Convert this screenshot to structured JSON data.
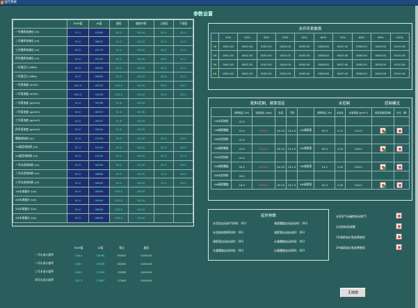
{
  "window": {
    "title": "运行系统"
  },
  "page": {
    "title": "参数设置"
  },
  "main_table": {
    "headers": [
      "",
      "RDM值",
      "AI值",
      "量程",
      "偏差补偿",
      "上限值",
      "下限值"
    ],
    "rows": [
      [
        "一号搅拌池液位 (m)",
        "21.1",
        "20584",
        "02.2",
        "00.00",
        "01.5",
        "01.4"
      ],
      [
        "二号搅拌池液位 (m)",
        "00.0",
        "08822",
        "02.2",
        "00.00",
        "01.5",
        "01.5"
      ],
      [
        "三号搅拌池液位 (m)",
        "00.0",
        "18770",
        "02.2",
        "00.00",
        "04.5",
        "01.2"
      ],
      [
        "四号搅拌池液位 (m)",
        "00.0",
        "09332",
        "02.2",
        "00.00",
        "04.5",
        "01.2"
      ],
      [
        "一号泵压力 (MPa)",
        "00.0",
        "08950",
        "25.0",
        "00.00",
        "05.0",
        "01.2"
      ],
      [
        "二号泵压力 (MPa)",
        "00.0",
        "08869",
        "25.0",
        "00.00",
        "05.0",
        "01.2"
      ],
      [
        "一号泵流量 (m3/h)",
        "000.0",
        "08325",
        "025.0",
        "00.00",
        "05.0",
        "00.2"
      ],
      [
        "二号泵流量 (m3/h)",
        "000.0",
        "09000",
        "025.0",
        "00.00",
        "05.0",
        "00.2"
      ],
      [
        "一号泵浓度 (g/cm3)",
        "00.0",
        "08789",
        "01.6",
        "00.00",
        "",
        ""
      ],
      [
        "二号泵浓度 (g/cm3)",
        "00.0",
        "08597",
        "01.6",
        "00.00",
        "",
        ""
      ],
      [
        "三号泵浓度 (g/cm3)",
        "00.0",
        "08057",
        "01.6",
        "00.00",
        "",
        ""
      ],
      [
        "四号泵浓度 (g/cm3)",
        "00.0",
        "08500",
        "01.6",
        "00.00",
        "",
        ""
      ],
      [
        "螺旋给料机 (m)",
        "02.8",
        "22029",
        "05.2",
        "00.00",
        "02.5",
        "00.5"
      ],
      [
        "1#粗泥给料机 (m)",
        "02.3",
        "22029",
        "05.2",
        "00.00",
        "02.3",
        "00.5"
      ],
      [
        "2#粗泥给料机 (m)",
        "00.0",
        "10000",
        "05.2",
        "00.00",
        "02.5",
        "01.3"
      ],
      [
        "一号水泥给料机 (m)",
        "00.0",
        "08900",
        "05.2",
        "00.00",
        "01.5",
        "00.5"
      ],
      [
        "二号水泥给料机 (m)",
        "00.0",
        "08860",
        "05.2",
        "00.00",
        "11.5",
        "00.5"
      ],
      [
        "三号水泥给料机 (m)",
        "00.0",
        "08600",
        "05.2",
        "00.00",
        "11.5",
        "00.5"
      ],
      [
        "1#水流量计 (L/s)",
        "00.0",
        "08900",
        "025.0",
        "00.00",
        "",
        ""
      ],
      [
        "2#水流量计 (L/s)",
        "00.0",
        "08900",
        "025.0",
        "00.00",
        "",
        ""
      ],
      [
        "3#水流量计 (L/s)",
        "00.0",
        "08800",
        "025.0",
        "00.00",
        "",
        ""
      ],
      [
        "4#水流量计 (L/s)",
        "00.0",
        "08800",
        "025.0",
        "00.00",
        "",
        ""
      ]
    ]
  },
  "flow_table": {
    "headers": [
      "",
      "RDM值",
      "AI值",
      "零点",
      "量值"
    ],
    "rows": [
      [
        "一号水流计量秤",
        "148.4",
        "18090",
        "00200",
        "0100.00"
      ],
      [
        "二号水流计量秤",
        "146.3",
        "20009",
        "00200",
        "0100.00"
      ],
      [
        "三号水流计量秤",
        "146.2",
        "17659",
        "15200",
        "0100.00"
      ],
      [
        "四号水流计量秤",
        "141.3",
        "17867",
        "17300",
        "0100.00"
      ]
    ]
  },
  "water_table": {
    "title": "水开环系数表",
    "headers": [
      "",
      "10%",
      "20%",
      "30%",
      "40%",
      "50%",
      "60%",
      "70%",
      "80%",
      "90%",
      "100%"
    ],
    "rows": [
      [
        "1#",
        "0001.00",
        "0002.00",
        "0003.00",
        "0004.00",
        "0005.00",
        "0006.00",
        "0007.00",
        "0008.00",
        "0009.00",
        "0010.00"
      ],
      [
        "2#",
        "0001.00",
        "0002.00",
        "0003.00",
        "0004.00",
        "0005.00",
        "0006.00",
        "0007.00",
        "0008.00",
        "0009.00",
        "0010.00"
      ],
      [
        "3#",
        "0001.00",
        "0002.00",
        "0003.00",
        "0004.00",
        "0005.00",
        "0006.00",
        "0007.00",
        "0008.00",
        "0009.00",
        "0010.00"
      ],
      [
        "4#",
        "0001.00",
        "0002.00",
        "0003.00",
        "0004.00",
        "0005.00",
        "0006.00",
        "0007.00",
        "0008.00",
        "0009.00",
        "0010.00"
      ]
    ]
  },
  "config": {
    "section_title": "配料控制、频率设定",
    "water_title": "水控制",
    "mode_title": "控制模式",
    "headers": [
      "",
      "频率给定 (Hz)",
      "流量设定 (kg/s)",
      "补偿",
      "下限",
      "",
      "频率给定 (Hz)",
      "水泥比",
      "水泥密度 (g/cm3)",
      "泥浆密度控制阀",
      "水开、调F"
    ],
    "rows": [
      [
        "1#水泥给料",
        "22.0",
        "",
        "",
        "",
        "",
        "",
        "",
        "",
        "",
        ""
      ],
      [
        "1#调浆螺旋",
        "22.0",
        "0000.0",
        "00.20",
        "011.0",
        "1#调浆泵",
        "00.0",
        "1.12",
        "112.0",
        "on",
        "F"
      ],
      [
        "2#水泥给料",
        "22.0",
        "",
        "",
        "",
        "",
        "",
        "",
        "",
        "",
        ""
      ],
      [
        "2#调浆螺旋",
        "22.0",
        "0000.0",
        "00.20",
        "011.0",
        "2#调浆泵",
        "00.0",
        "1.00",
        "150.0",
        "on",
        "F"
      ],
      [
        "3#水泥给料",
        "22.0",
        "",
        "",
        "",
        "",
        "",
        "",
        "",
        "",
        ""
      ],
      [
        "3#调浆螺旋",
        "26.0",
        "0000.0",
        "00.20",
        "011.0",
        "3#调浆泵",
        "15.2",
        "1.00",
        "200.0",
        "on",
        "F"
      ],
      [
        "4#水泥给料",
        "16.0",
        "",
        "",
        "",
        "",
        "",
        "",
        "",
        "",
        ""
      ],
      [
        "4#调浆螺旋",
        "16.0",
        "0000.0",
        "00.20",
        "011.0",
        "4#调浆泵",
        "20.4",
        "1.00",
        "100.0",
        "on",
        "F"
      ]
    ]
  },
  "delay": {
    "title": "延时参数",
    "items": [
      {
        "label": "水泥仓自动吹气时间:",
        "value": "003"
      },
      {
        "label": "调浆螺旋自动启动时:",
        "value": "003"
      },
      {
        "label": "水泥给料频率时间:",
        "value": "003"
      },
      {
        "label": "调浆泵自动启动时:",
        "value": "003"
      },
      {
        "label": "调浆泵自动启动时:",
        "value": "003"
      },
      {
        "label": "计量螺旋启动时间:",
        "value": "003"
      },
      {
        "label": "计量螺旋启动时间:",
        "value": "003"
      },
      {
        "label": "计量螺旋启动停机:",
        "value": "003"
      }
    ]
  },
  "options": [
    {
      "label": "水泥仓气动破拱启动吹气"
    },
    {
      "label": "水泥给料机调零"
    },
    {
      "label": "1#调浆流水泵选择使用"
    },
    {
      "label": "2#调浆流水泵选择使用"
    }
  ],
  "main_button": "主画面"
}
